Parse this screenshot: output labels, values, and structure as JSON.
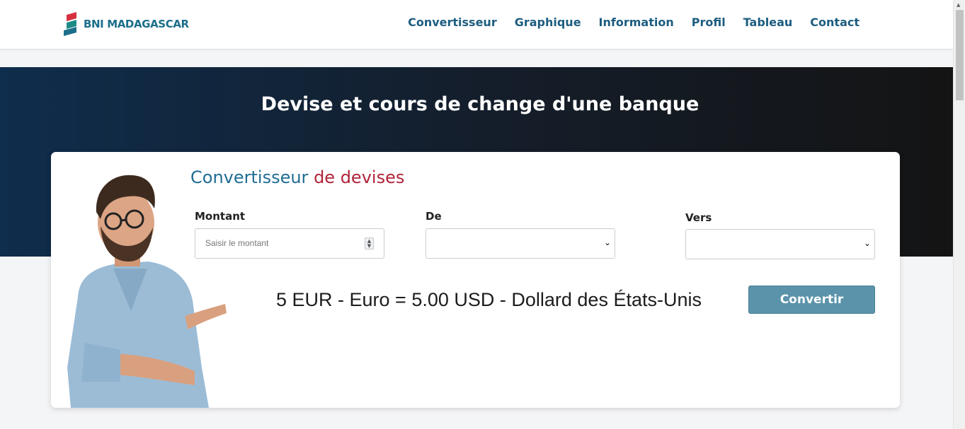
{
  "brand": {
    "name": "BNI MADAGASCAR",
    "colors": {
      "red": "#d6303f",
      "teal": "#1b6f8a"
    }
  },
  "nav": {
    "items": [
      "Convertisseur",
      "Graphique",
      "Information",
      "Profil",
      "Tableau",
      "Contact"
    ]
  },
  "hero": {
    "title": "Devise et cours de change d'une banque"
  },
  "converter": {
    "title_part1": "Convertisseur",
    "title_part2": "de devises",
    "amount_label": "Montant",
    "amount_placeholder": "Saisir le montant",
    "amount_value": "",
    "from_label": "De",
    "from_value": "",
    "to_label": "Vers",
    "to_value": "",
    "result": "5 EUR - Euro = 5.00 USD - Dollard des États-Unis",
    "button_label": "Convertir"
  },
  "icons": {
    "spinner": "number-spinner-icon",
    "select_caret": "chevron-down-icon",
    "logo": "bni-logo-icon"
  }
}
